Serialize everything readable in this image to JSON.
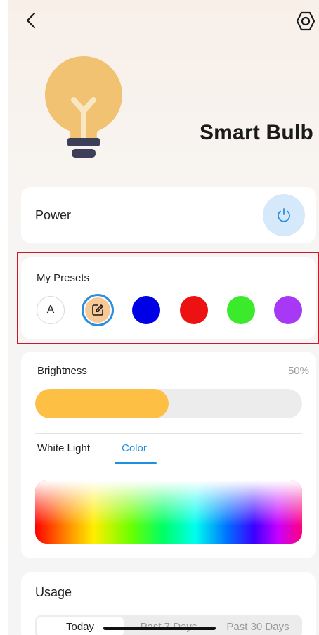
{
  "header": {
    "back_icon": "chevron-left-icon",
    "settings_icon": "hexagon-settings-icon"
  },
  "device": {
    "name": "Smart Bulb",
    "icon": "light-bulb-icon",
    "bulb_color": "#f0c272"
  },
  "power": {
    "label": "Power",
    "icon": "power-icon",
    "accent": "#2a8fe0"
  },
  "presets": {
    "title": "My Presets",
    "auto_label": "A",
    "edit_icon": "edit-icon",
    "colors": [
      "#0000e6",
      "#ee1111",
      "#3cea2c",
      "#a738f5"
    ]
  },
  "brightness": {
    "label": "Brightness",
    "value": "50%",
    "level": 0.5,
    "fill_color": "#fdc045"
  },
  "mode_tabs": {
    "white_light": "White Light",
    "color": "Color",
    "active": "Color"
  },
  "usage": {
    "title": "Usage",
    "tabs": [
      "Today",
      "Past 7 Days",
      "Past 30 Days"
    ],
    "active": "Today"
  }
}
